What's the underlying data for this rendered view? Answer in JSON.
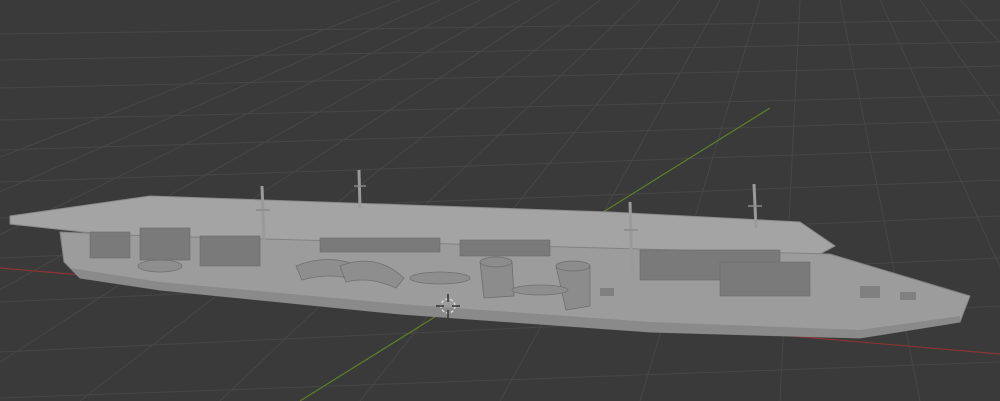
{
  "viewport": {
    "background_color": "#3a3a3a",
    "grid_color": "#454545",
    "x_axis_color": "#9a3a3a",
    "y_axis_color": "#5c7a2a",
    "model_color": "#9e9e9e",
    "model_shadow_color": "#6e6e6e",
    "model_highlight_color": "#b4b4b4"
  },
  "scene": {
    "object": "aircraft-carrier-model",
    "origin_icon": "3d-cursor-icon"
  }
}
